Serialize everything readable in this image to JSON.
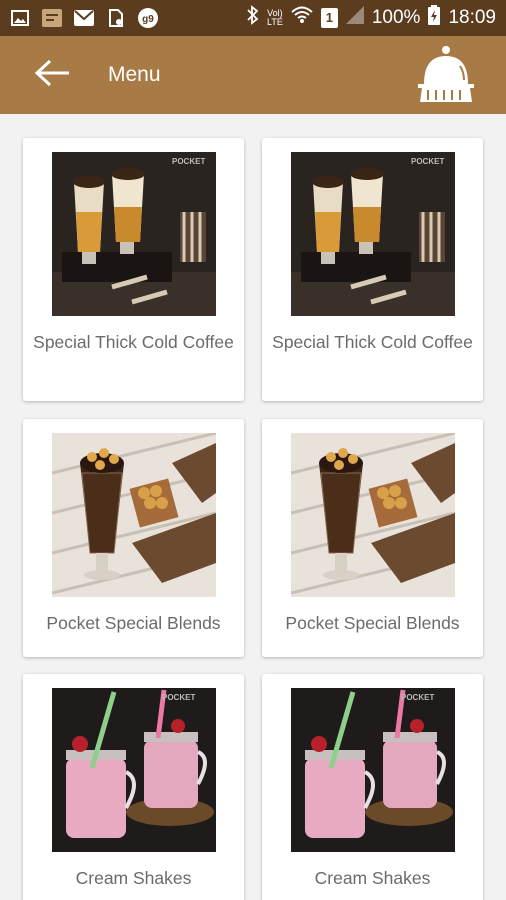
{
  "statusbar": {
    "left_icons": [
      "image-icon",
      "notification-icon",
      "mail-icon",
      "sim-icon",
      "g-icon"
    ],
    "volte_top": "Vol)",
    "volte_bottom": "LTE",
    "sim_slot": "1",
    "battery_percent": "100%",
    "time": "18:09"
  },
  "appbar": {
    "title": "Menu",
    "back_icon": "arrow-left-icon",
    "action_icon": "cloche-icon",
    "background": "#a87a46"
  },
  "menu": {
    "items": [
      {
        "label": "Special Thick Cold Coffee",
        "image": "cold-coffee-photo"
      },
      {
        "label": "Special Thick Cold Coffee",
        "image": "cold-coffee-photo"
      },
      {
        "label": "Pocket Special Blends",
        "image": "blends-photo"
      },
      {
        "label": "Pocket Special Blends",
        "image": "blends-photo"
      },
      {
        "label": "Cream Shakes",
        "image": "cream-shakes-photo"
      },
      {
        "label": "Cream Shakes",
        "image": "cream-shakes-photo"
      }
    ]
  }
}
